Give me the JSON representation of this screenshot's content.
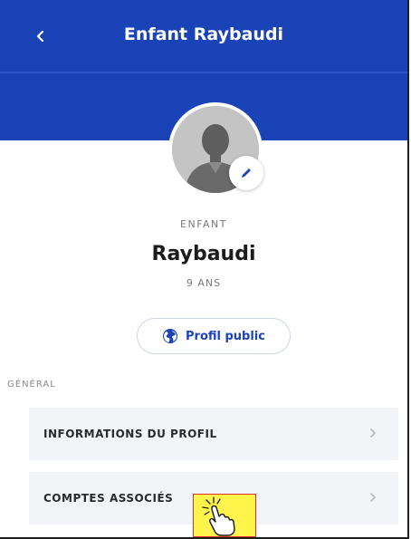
{
  "header": {
    "title": "Enfant Raybaudi",
    "back_icon": "chevron-left-icon",
    "color": "#1b43b8"
  },
  "profile": {
    "role": "ENFANT",
    "name": "Raybaudi",
    "age": "9 ANS",
    "avatar_icon": "user-silhouette-icon",
    "edit_icon": "pencil-icon",
    "public_profile_button": "Profil public",
    "public_profile_icon": "globe-icon"
  },
  "sections": {
    "general_label": "GÉNÉRAL",
    "items": [
      {
        "label": "INFORMATIONS DU PROFIL",
        "icon": "chevron-right-icon"
      },
      {
        "label": "COMPTES ASSOCIÉS",
        "icon": "chevron-right-icon"
      }
    ]
  },
  "overlay": {
    "cursor_icon": "hand-pointer-click-icon",
    "highlight_color": "#fff44a"
  }
}
